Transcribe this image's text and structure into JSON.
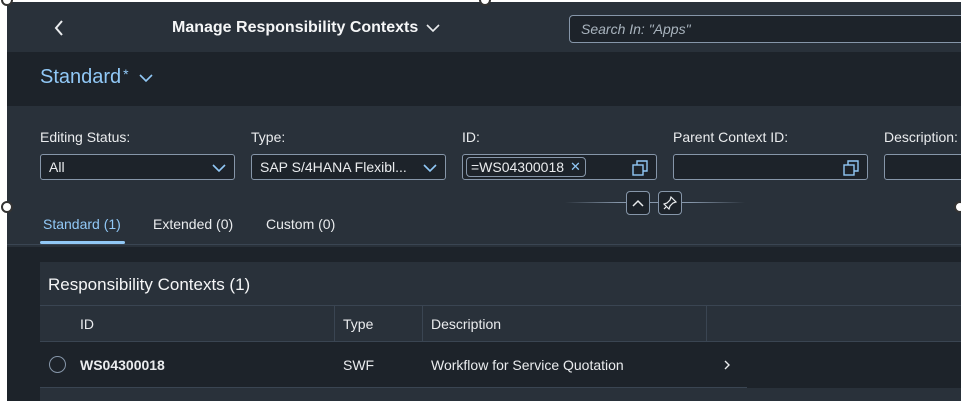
{
  "shell": {
    "title": "Manage Responsibility Contexts",
    "search_placeholder": "Search In: \"Apps\""
  },
  "variant": {
    "name": "Standard",
    "modified_marker": "*"
  },
  "filters": [
    {
      "label": "Editing Status:",
      "value": "All",
      "control": "select"
    },
    {
      "label": "Type:",
      "value": "SAP S/4HANA Flexibl...",
      "control": "select"
    },
    {
      "label": "ID:",
      "token": "=WS04300018",
      "control": "multi-input"
    },
    {
      "label": "Parent Context ID:",
      "value": "",
      "control": "value-help"
    },
    {
      "label": "Description:",
      "value": "",
      "control": "input"
    }
  ],
  "tabs": [
    {
      "label": "Standard (1)",
      "active": true
    },
    {
      "label": "Extended (0)",
      "active": false
    },
    {
      "label": "Custom (0)",
      "active": false
    }
  ],
  "table": {
    "title": "Responsibility Contexts (1)",
    "columns": [
      "ID",
      "Type",
      "Description"
    ],
    "rows": [
      {
        "id": "WS04300018",
        "type": "SWF",
        "description": "Workflow for Service Quotation"
      }
    ]
  },
  "icons": {
    "back": "chevron-left-icon",
    "title_menu": "chevron-down-icon",
    "variant_menu": "chevron-down-icon",
    "dropdown": "chevron-down-icon",
    "value_help": "value-help-icon",
    "token_remove": "close-icon",
    "collapse": "chevron-up-icon",
    "pin": "pin-icon",
    "row_nav": "chevron-right-icon"
  },
  "colors": {
    "shell_bg": "#29313a",
    "page_bg": "#1d232a",
    "accent": "#91c8f6",
    "text": "#eaecee",
    "border": "#8696a9"
  }
}
